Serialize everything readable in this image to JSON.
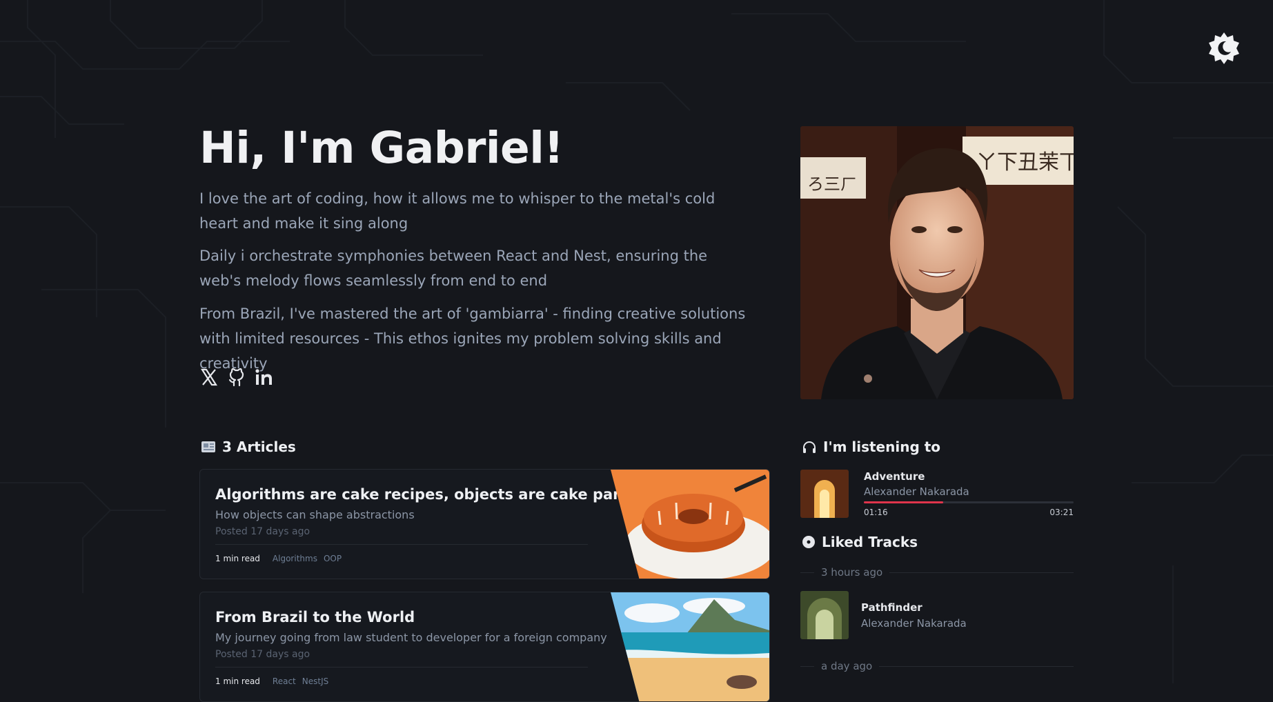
{
  "hero": {
    "title": "Hi, I'm Gabriel!",
    "bio": [
      "I love the art of coding, how it allows me to whisper to the metal's cold heart and make it sing along",
      "Daily i orchestrate symphonies between React and Nest, ensuring the web's melody flows seamlessly from end to end",
      "From Brazil, I've mastered the art of 'gambiarra' - finding creative solutions with limited resources - This ethos ignites my problem solving skills and creativity"
    ]
  },
  "socials": [
    {
      "icon": "x-icon"
    },
    {
      "icon": "github-icon"
    },
    {
      "icon": "linkedin-icon"
    }
  ],
  "theme_toggle": {
    "icon": "moon-icon"
  },
  "articles_section": {
    "icon": "newspaper-icon",
    "heading": "3 Articles",
    "items": [
      {
        "title": "Algorithms are cake recipes, objects are cake pans",
        "subtitle": "How objects can shape abstractions",
        "date": "Posted 17 days ago",
        "read_time": "1 min read",
        "tags": [
          "Algorithms",
          "OOP"
        ],
        "image": "cake-illustration"
      },
      {
        "title": "From Brazil to the World",
        "subtitle": "My journey going from law student to developer for a foreign company",
        "date": "Posted 17 days ago",
        "read_time": "1 min read",
        "tags": [
          "React",
          "NestJS"
        ],
        "image": "beach-illustration"
      }
    ]
  },
  "listening": {
    "icon": "headphones-icon",
    "heading": "I'm listening to",
    "track": {
      "title": "Adventure",
      "artist": "Alexander Nakarada",
      "elapsed": "01:16",
      "duration": "03:21",
      "progress": 0.378
    }
  },
  "liked": {
    "icon": "disc-icon",
    "heading": "Liked Tracks",
    "groups": [
      {
        "label": "3 hours ago",
        "tracks": [
          {
            "title": "Pathfinder",
            "artist": "Alexander Nakarada"
          }
        ]
      },
      {
        "label": "a day ago",
        "tracks": []
      }
    ]
  },
  "colors": {
    "background": "#15171c",
    "accent": "#e0344c",
    "muted_text": "#9ba6b8"
  }
}
